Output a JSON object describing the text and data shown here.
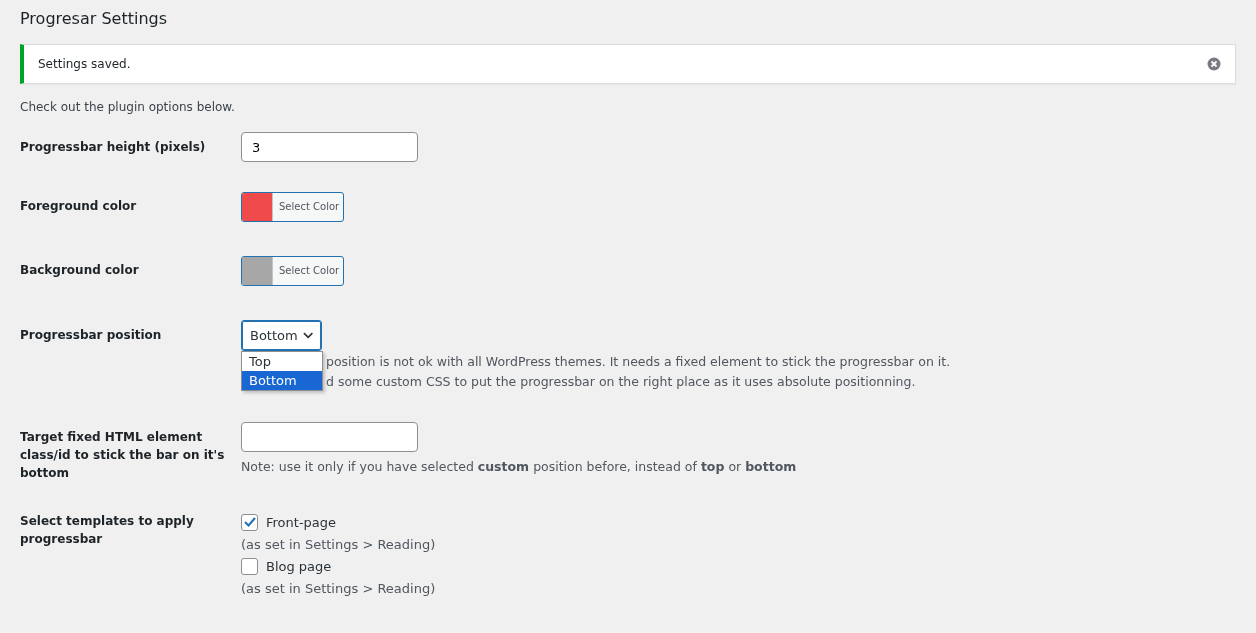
{
  "page_title": "Progresar Settings",
  "notice": {
    "text": "Settings saved."
  },
  "intro": "Check out the plugin options below.",
  "fields": [
    {
      "kind": "text",
      "label": "Progressbar height (pixels)",
      "value": "3"
    },
    {
      "kind": "color",
      "label": "Foreground color",
      "color": "#ef4b4b",
      "button": "Select Color"
    },
    {
      "kind": "color",
      "label": "Background color",
      "color": "#a7a7a7",
      "button": "Select Color"
    },
    {
      "kind": "select",
      "label": "Progressbar position",
      "value": "Bottom",
      "options": [
        {
          "label": "Top",
          "selected": false
        },
        {
          "label": "Bottom",
          "selected": true
        }
      ],
      "description": [
        "position is not ok with all WordPress themes. It needs a fixed element to stick the progressbar on it.",
        "d some custom CSS to put the progressbar on the right place as it uses absolute positionning."
      ]
    },
    {
      "kind": "text",
      "label": "Target fixed HTML element class/id to stick the bar on it's bottom",
      "description": [
        "Note: use it only if you have selected **custom** position before, instead of **top** or **bottom**"
      ]
    },
    {
      "kind": "checkboxes",
      "label": "Select templates to apply progressbar",
      "items": [
        {
          "label": "Front-page",
          "checked": true,
          "hint": "(as set in Settings > Reading)"
        },
        {
          "label": "Blog page",
          "checked": false,
          "hint": "(as set in Settings > Reading)"
        }
      ]
    }
  ]
}
